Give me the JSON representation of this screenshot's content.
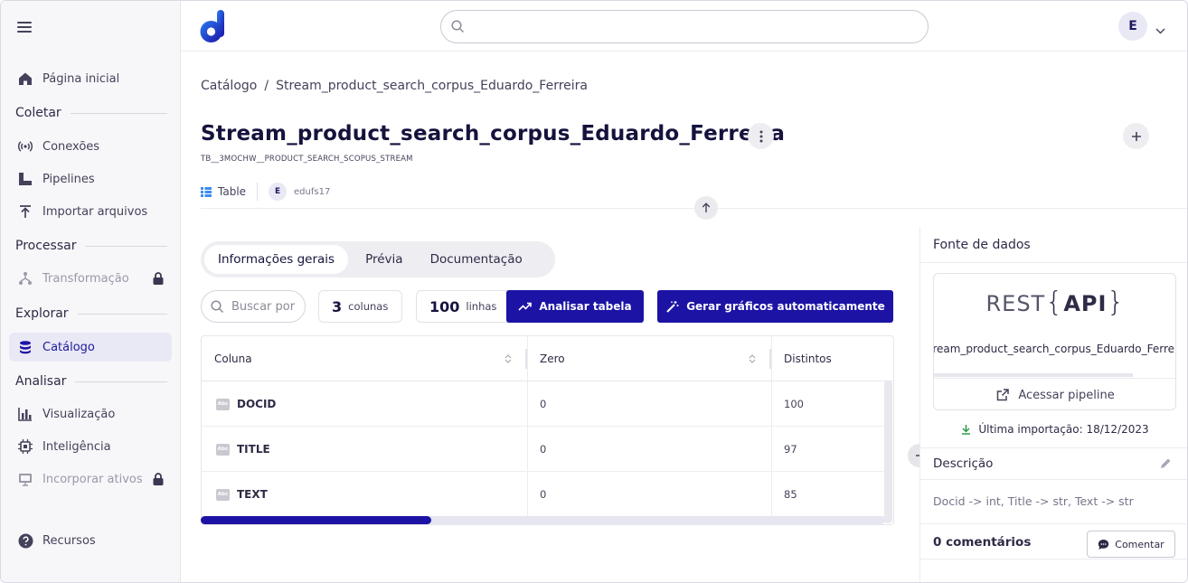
{
  "sidebar": {
    "items": [
      {
        "label": "Página inicial",
        "icon": "home-icon"
      },
      {
        "label": "Conexões",
        "icon": "antenna-icon"
      },
      {
        "label": "Pipelines",
        "icon": "pipeline-icon"
      },
      {
        "label": "Importar arquivos",
        "icon": "upload-icon"
      },
      {
        "label": "Transformação",
        "icon": "transform-icon"
      },
      {
        "label": "Catálogo",
        "icon": "database-icon"
      },
      {
        "label": "Visualização",
        "icon": "bar-chart-icon"
      },
      {
        "label": "Inteligência",
        "icon": "chip-icon"
      },
      {
        "label": "Incorporar ativos",
        "icon": "embed-icon"
      },
      {
        "label": "Recursos",
        "icon": "help-icon"
      }
    ],
    "sections": {
      "coletar": "Coletar",
      "processar": "Processar",
      "explorar": "Explorar",
      "analisar": "Analisar"
    }
  },
  "header": {
    "avatar_initial": "E",
    "search_placeholder": ""
  },
  "breadcrumb": {
    "root": "Catálogo",
    "separator": "/",
    "current": "Stream_product_search_corpus_Eduardo_Ferreira"
  },
  "asset": {
    "title": "Stream_product_search_corpus_Eduardo_Ferreira",
    "table_id": "TB__3MOCHW__PRODUCT_SEARCH_SCOPUS_STREAM",
    "type": "Table",
    "owner_initial": "E",
    "owner": "edufs17"
  },
  "tabs": [
    "Informações gerais",
    "Prévia",
    "Documentação"
  ],
  "toolbar": {
    "search_placeholder": "Buscar por coluna",
    "columns_count": "3",
    "columns_label": "colunas",
    "rows_count": "100",
    "rows_label": "linhas",
    "analyze_label": "Analisar tabela",
    "charts_label": "Gerar gráficos automaticamente"
  },
  "table": {
    "headers": [
      "Coluna",
      "Zero",
      "Distintos"
    ],
    "type_icon_text": "Abc",
    "rows": [
      {
        "name": "DOCID",
        "zero": "0",
        "distinct": "100"
      },
      {
        "name": "TITLE",
        "zero": "0",
        "distinct": "97"
      },
      {
        "name": "TEXT",
        "zero": "0",
        "distinct": "85"
      }
    ]
  },
  "right_panel": {
    "source_heading": "Fonte de dados",
    "logo_rest": "REST",
    "logo_open_brace": "{",
    "logo_api": "API",
    "logo_close_brace": "}",
    "source_name": "Stream_product_search_corpus_Eduardo_Ferreira",
    "access_pipeline": "Acessar pipeline",
    "last_import": "Última importação: 18/12/2023",
    "description_heading": "Descrição",
    "description_text": "Docid -> int, Title -> str, Text -> str",
    "comments_label": "0 comentários",
    "comment_button": "Comentar"
  },
  "colors": {
    "primary": "#1c13a5",
    "active_nav_bg": "#e9e8f5",
    "title": "#15133d"
  }
}
